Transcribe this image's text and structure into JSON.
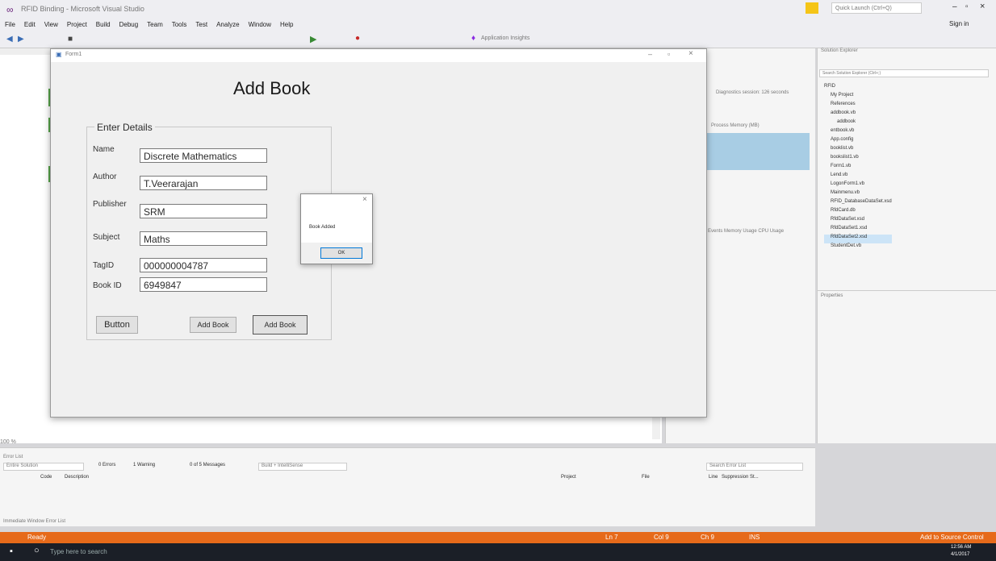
{
  "vs": {
    "title": "RFID Binding - Microsoft Visual Studio",
    "menu": [
      "File",
      "Edit",
      "View",
      "Project",
      "Build",
      "Debug",
      "Team",
      "Tools",
      "Test",
      "Analyze",
      "Window",
      "Help"
    ],
    "quick_launch_placeholder": "Quick Launch (Ctrl+Q)",
    "sign_in": "Sign in",
    "app_insights": "Application Insights",
    "zoom": "100 %"
  },
  "form": {
    "window_title": "Form1",
    "heading": "Add Book",
    "group_title": "Enter Details",
    "fields": [
      {
        "label": "Name",
        "value": "Discrete Mathematics"
      },
      {
        "label": "Author",
        "value": "T.Veerarajan"
      },
      {
        "label": "Publisher",
        "value": "SRM"
      },
      {
        "label": "Subject",
        "value": "Maths"
      },
      {
        "label": "TagID",
        "value": "000000004787"
      },
      {
        "label": "Book ID",
        "value": "6949847"
      }
    ],
    "button_left": "Button",
    "button_mid": "Add Book",
    "button_right": "Add Book"
  },
  "messagebox": {
    "text": "Book Added",
    "ok": "OK",
    "close": "×"
  },
  "solution_explorer": {
    "title": "Solution Explorer",
    "search_placeholder": "Search Solution Explorer (Ctrl+;)",
    "items": [
      "RFID",
      "My Project",
      "References",
      "addbook.vb",
      "addbook",
      "entbook.vb",
      "App.config",
      "booklist.vb",
      "bookslist1.vb",
      "Form1.vb",
      "Lend.vb",
      "LogonForm1.vb",
      "Mainmenu.vb",
      "RFID_DatabaseDataSet.xsd",
      "RfdCard.db",
      "RfdDataSet.xsd",
      "RfdDataSet1.xsd",
      "RfdDataSet2.xsd",
      "StudentDet.vb"
    ]
  },
  "properties": {
    "title": "Properties"
  },
  "diagnostics": {
    "session": "Diagnostics session: 126 seconds",
    "process_memory": "Process Memory (MB)",
    "tabs": "Events   Memory Usage   CPU Usage"
  },
  "error_list": {
    "title": "Error List",
    "scope": "Entire Solution",
    "errors": "0 Errors",
    "warnings": "1 Warning",
    "messages": "0 of 5 Messages",
    "build": "Build + IntelliSense",
    "search": "Search Error List",
    "columns": [
      "Code",
      "Description",
      "Project",
      "File",
      "Line",
      "Suppression St..."
    ],
    "bottom_tabs": "Immediate Window   Error List"
  },
  "status": {
    "ready": "Ready",
    "ln": "Ln 7",
    "col": "Col 9",
    "ch": "Ch 9",
    "ins": "INS",
    "source_control": "Add to Source Control"
  },
  "taskbar": {
    "search": "Type here to search",
    "time": "12:56 AM",
    "date": "4/1/2017"
  }
}
